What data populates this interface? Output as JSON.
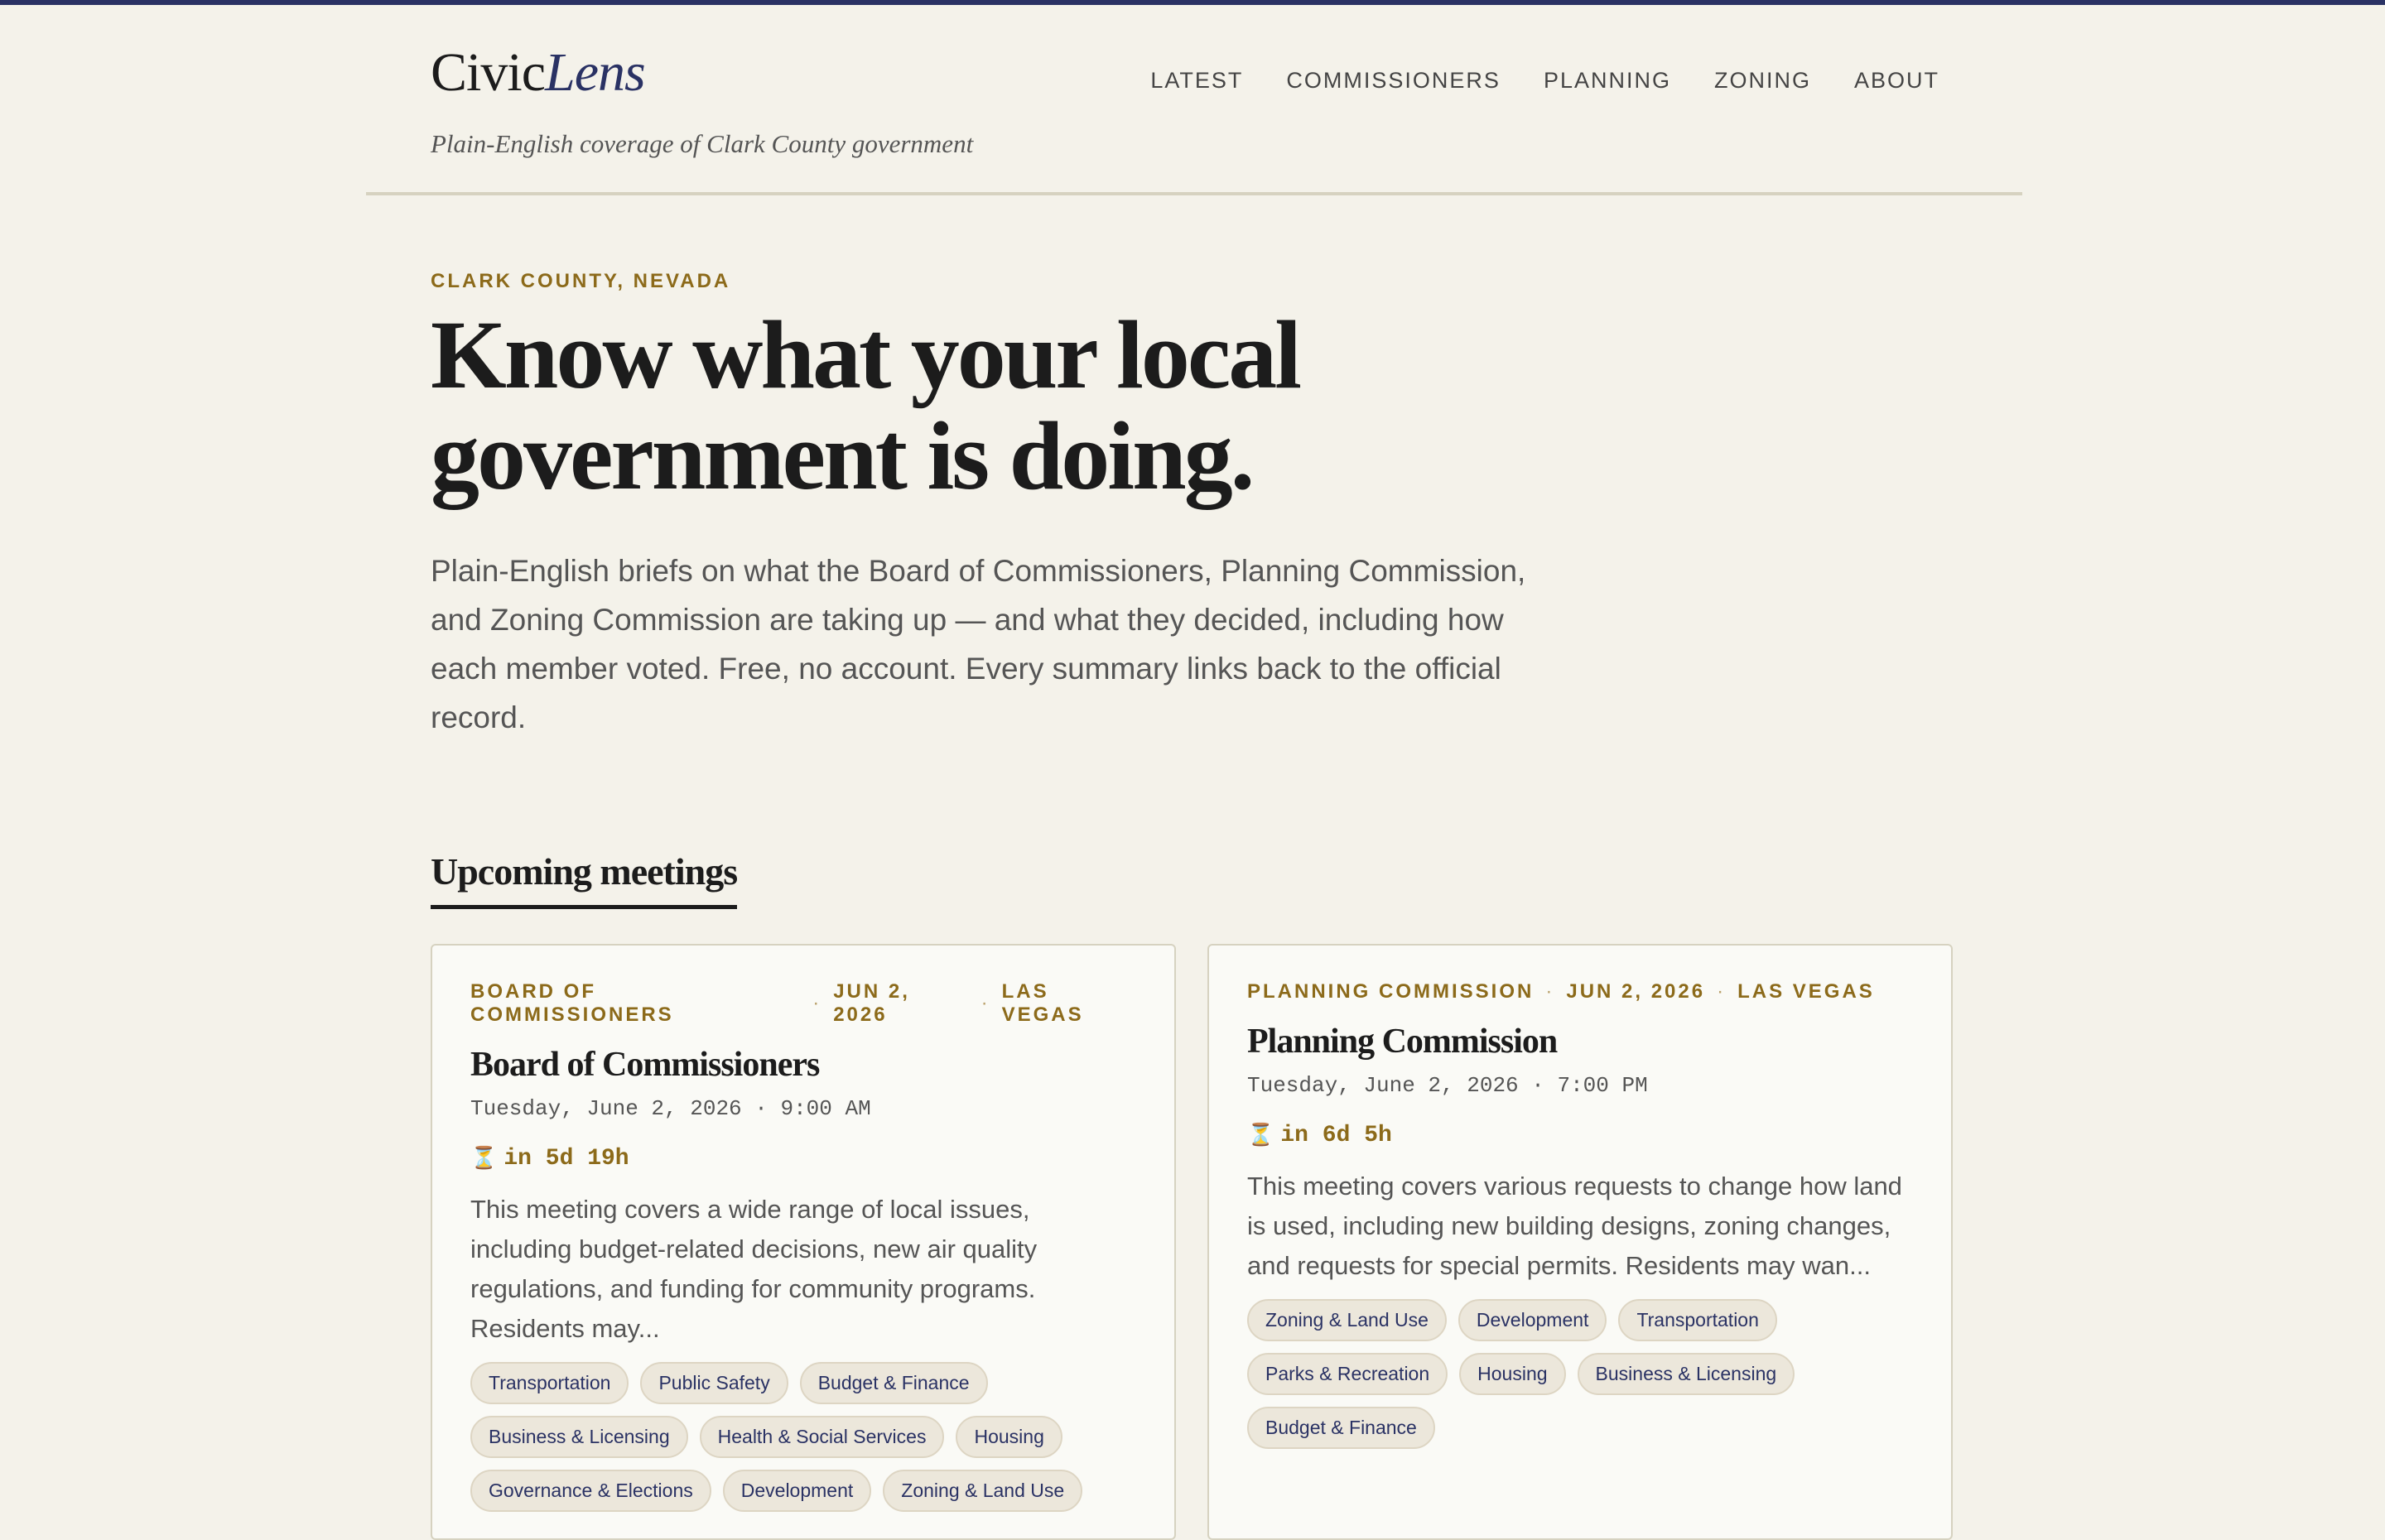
{
  "header": {
    "logo_part1": "Civic",
    "logo_part2": "Lens",
    "tagline": "Plain-English coverage of Clark County government",
    "nav": [
      "LATEST",
      "COMMISSIONERS",
      "PLANNING",
      "ZONING",
      "ABOUT"
    ]
  },
  "hero": {
    "eyebrow": "CLARK COUNTY, NEVADA",
    "title": "Know what your local government is doing.",
    "lead": "Plain-English briefs on what the Board of Commissioners, Planning Commission, and Zoning Commission are taking up — and what they decided, including how each member voted. Free, no account. Every summary links back to the official record."
  },
  "upcoming": {
    "section_title": "Upcoming meetings",
    "meetings": [
      {
        "body": "BOARD OF COMMISSIONERS",
        "date": "JUN 2, 2026",
        "city": "LAS VEGAS",
        "title": "Board of Commissioners",
        "when": "Tuesday, June 2, 2026 · 9:00 AM",
        "countdown": "in 5d 19h",
        "summary": "This meeting covers a wide range of local issues, including budget-related decisions, new air quality regulations, and funding for community programs. Residents may...",
        "tags": [
          "Transportation",
          "Public Safety",
          "Budget & Finance",
          "Business & Licensing",
          "Health & Social Services",
          "Housing",
          "Governance & Elections",
          "Development",
          "Zoning & Land Use"
        ]
      },
      {
        "body": "PLANNING COMMISSION",
        "date": "JUN 2, 2026",
        "city": "LAS VEGAS",
        "title": "Planning Commission",
        "when": "Tuesday, June 2, 2026 · 7:00 PM",
        "countdown": "in 6d 5h",
        "summary": "This meeting covers various requests to change how land is used, including new building designs, zoning changes, and requests for special permits. Residents may wan...",
        "tags": [
          "Zoning & Land Use",
          "Development",
          "Transportation",
          "Parks & Recreation",
          "Housing",
          "Business & Licensing",
          "Budget & Finance"
        ]
      }
    ]
  },
  "icons": {
    "countdown": "hourglass-icon"
  },
  "colors": {
    "accent_navy": "#2a3264",
    "accent_gold": "#8c6a1a",
    "background": "#f4f2ea"
  }
}
